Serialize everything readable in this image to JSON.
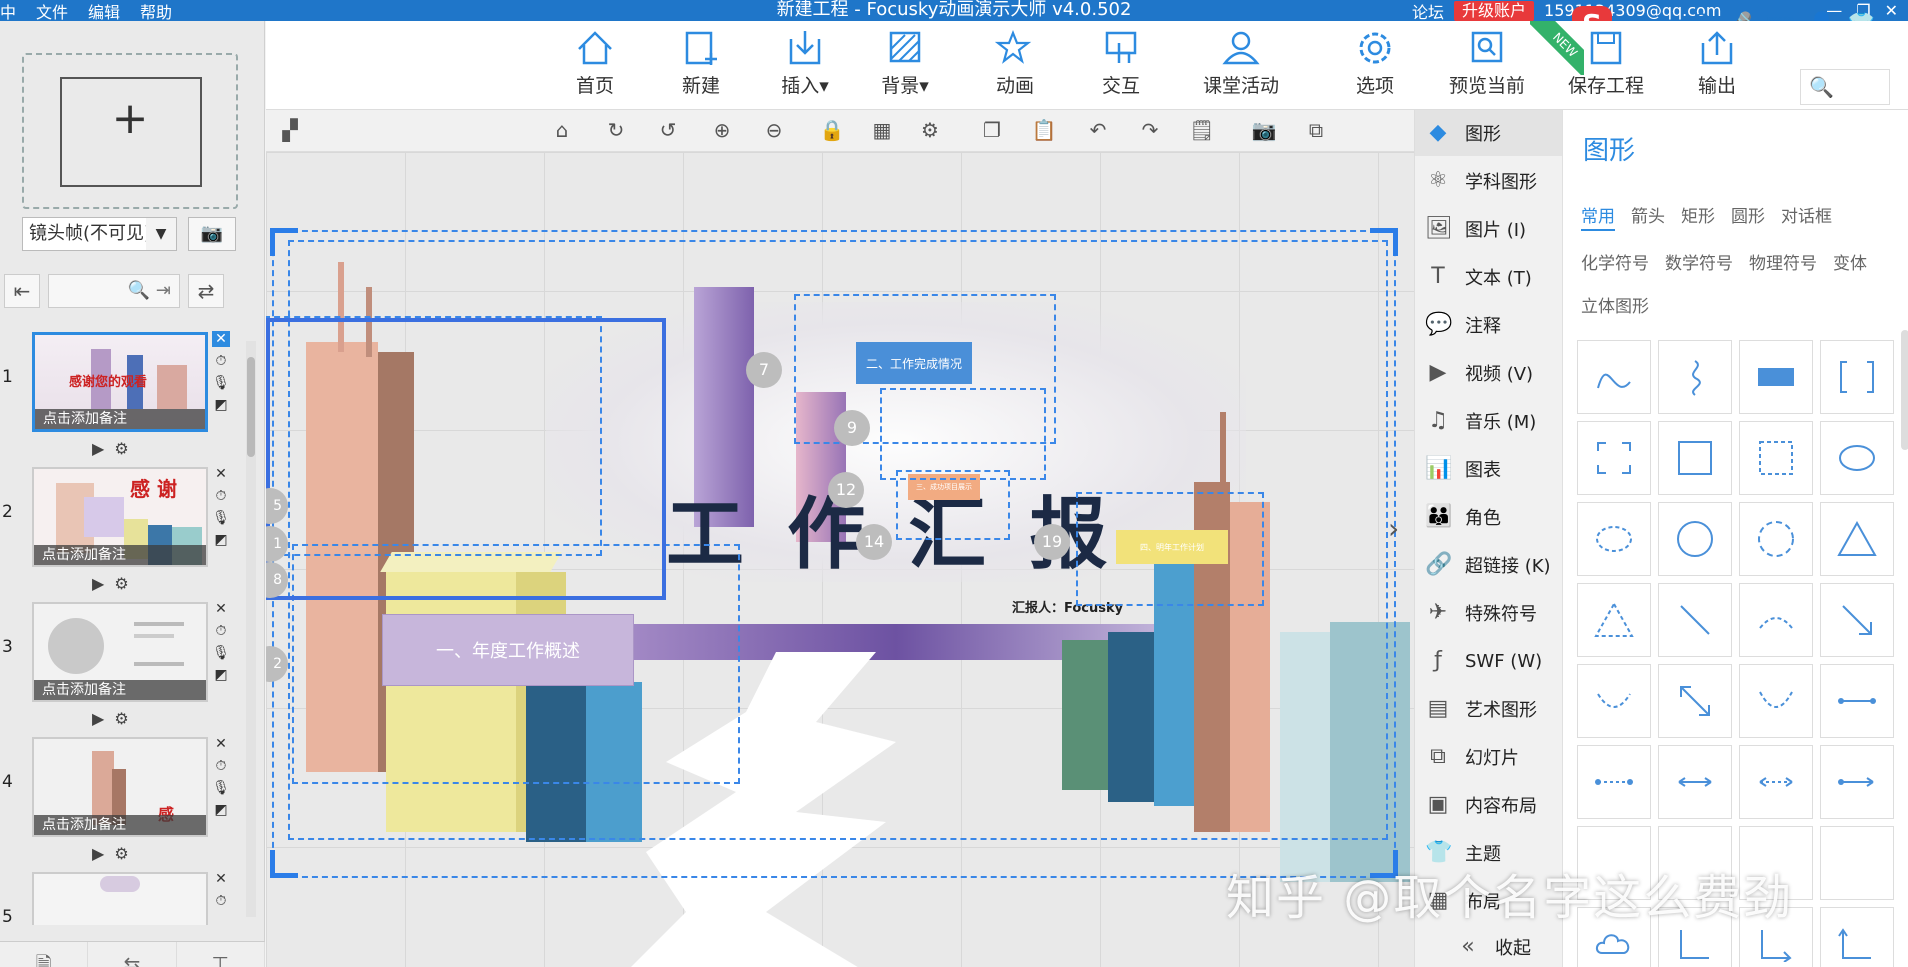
{
  "titlebar": {
    "menu": [
      "中",
      "文件",
      "编辑",
      "帮助"
    ],
    "title": "新建工程 - Focusky动画演示大师  v4.0.502",
    "forum": "论坛",
    "upgrade": "升级账户",
    "email": "1591134309@qq.com",
    "sogou": [
      "S",
      "中",
      "•,",
      "☺",
      "🎤",
      "⌨",
      "👤",
      "👕",
      "▦"
    ]
  },
  "left": {
    "camera_select": "镜头帧(不可见)",
    "slides": [
      {
        "num": "1",
        "note": "点击添加备注",
        "thumb_text": "感谢您的观看"
      },
      {
        "num": "2",
        "note": "点击添加备注",
        "thumb_text": "感 谢"
      },
      {
        "num": "3",
        "note": "点击添加备注",
        "thumb_text": ""
      },
      {
        "num": "4",
        "note": "点击添加备注",
        "thumb_text": "感"
      },
      {
        "num": "5",
        "note": "",
        "thumb_text": ""
      }
    ]
  },
  "toolbar": {
    "items": [
      "首页",
      "新建",
      "插入",
      "背景",
      "动画",
      "交互",
      "课堂活动",
      "选项",
      "预览当前",
      "保存工程",
      "输出"
    ],
    "new_badge": "NEW"
  },
  "canvas": {
    "main_title": "工 作 汇 报",
    "reporter": "汇报人：Focusky",
    "box1": "一、年度工作概述",
    "box2": "二、工作完成情况",
    "box3": "三、成功项目展示",
    "box4": "四、明年工作计划",
    "markers": [
      "7",
      "9",
      "12",
      "14",
      "19",
      "5",
      "1",
      "8",
      "2"
    ]
  },
  "rightpanel": {
    "items": [
      "图形",
      "学科图形",
      "图片 (I)",
      "文本 (T)",
      "注释",
      "视频 (V)",
      "音乐 (M)",
      "图表",
      "角色",
      "超链接 (K)",
      "特殊符号",
      "SWF (W)",
      "艺术图形",
      "幻灯片",
      "内容布局",
      "主题",
      "布局"
    ],
    "collapse": "收起"
  },
  "shapes": {
    "title": "图形",
    "categories": [
      "常用",
      "箭头",
      "矩形",
      "圆形",
      "对话框",
      "化学符号",
      "数学符号",
      "物理符号",
      "变体",
      "立体图形"
    ]
  },
  "watermark": "知乎 @取个名字这么费劲",
  "colors": {
    "accent": "#2d8be0",
    "titlebar": "#1f76c9",
    "upgrade": "#e8393b"
  }
}
